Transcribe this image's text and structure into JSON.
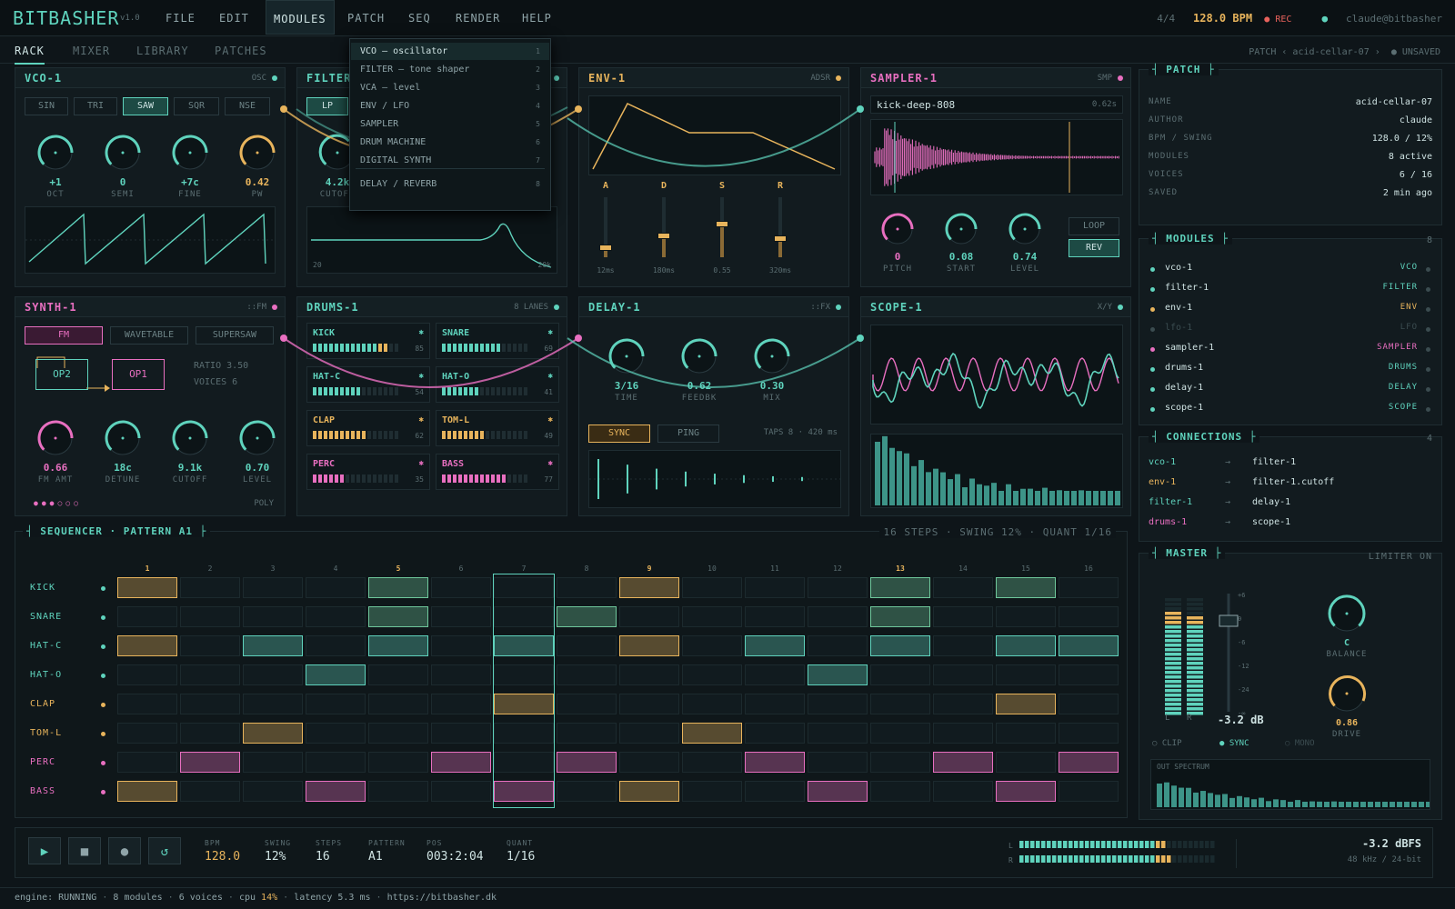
{
  "app": {
    "name": "BITBASHER",
    "version": "v1.0"
  },
  "menu": [
    "FILE",
    "EDIT",
    "MODULES",
    "PATCH",
    "SEQ",
    "RENDER",
    "HELP"
  ],
  "topbar": {
    "sig": "4/4",
    "bpm": "128.0 BPM",
    "rec": "● REC",
    "user": "claude@bitbasher"
  },
  "tabs": [
    "RACK",
    "MIXER",
    "LIBRARY",
    "PATCHES"
  ],
  "breadcrumb": {
    "text": "PATCH ‹ acid-cellar-07 ›",
    "status": "● UNSAVED"
  },
  "dropdown": [
    {
      "label": "VCO — oscillator",
      "key": "1"
    },
    {
      "label": "FILTER — tone shaper",
      "key": "2"
    },
    {
      "label": "VCA — level",
      "key": "3"
    },
    {
      "label": "ENV / LFO",
      "key": "4"
    },
    {
      "label": "SAMPLER",
      "key": "5"
    },
    {
      "label": "DRUM MACHINE",
      "key": "6"
    },
    {
      "label": "DIGITAL SYNTH",
      "key": "7"
    },
    {
      "label": "DELAY / REVERB",
      "key": "8"
    }
  ],
  "vco": {
    "title": "VCO-1",
    "tag": "OSC",
    "waves": [
      "SIN",
      "TRI",
      "SAW",
      "SQR",
      "NSE"
    ],
    "active_wave": "SAW",
    "knobs": [
      {
        "v": "+1",
        "l": "OCT"
      },
      {
        "v": "0",
        "l": "SEMI"
      },
      {
        "v": "+7c",
        "l": "FINE"
      },
      {
        "v": "0.42",
        "l": "PW"
      }
    ]
  },
  "filter": {
    "title": "FILTER-1",
    "mode": "LP",
    "cutoff_value": "4.2k",
    "cutoff_label": "CUTOFF",
    "axis_min": "20",
    "axis_max": "20k"
  },
  "env": {
    "title": "ENV-1",
    "tag": "ADSR",
    "sliders": [
      {
        "n": "A",
        "v": "12ms",
        "level": 0.15
      },
      {
        "n": "D",
        "v": "180ms",
        "level": 0.35
      },
      {
        "n": "S",
        "v": "0.55",
        "level": 0.55
      },
      {
        "n": "R",
        "v": "320ms",
        "level": 0.3
      }
    ]
  },
  "sampler": {
    "title": "SAMPLER-1",
    "tag": "SMP",
    "file": "kick-deep-808",
    "length": "0.62s",
    "loop": "LOOP",
    "rev": "REV",
    "knobs": [
      {
        "v": "0",
        "l": "PITCH"
      },
      {
        "v": "0.08",
        "l": "START"
      },
      {
        "v": "0.74",
        "l": "LEVEL"
      }
    ]
  },
  "synth": {
    "title": "SYNTH-1",
    "tag": "::FM",
    "modes": [
      "FM",
      "WAVETABLE",
      "SUPERSAW"
    ],
    "op2": "OP2",
    "op1": "OP1",
    "ratio": "RATIO 3.50",
    "voices": "VOICES  6",
    "poly": "POLY",
    "knobs": [
      {
        "v": "0.66",
        "l": "FM AMT"
      },
      {
        "v": "18c",
        "l": "DETUNE"
      },
      {
        "v": "9.1k",
        "l": "CUTOFF"
      },
      {
        "v": "0.70",
        "l": "LEVEL"
      }
    ]
  },
  "drums": {
    "title": "DRUMS-1",
    "tag": "8 LANES",
    "lanes": [
      {
        "n": "KICK",
        "v": "85",
        "c": "teal",
        "lvl": 0.85
      },
      {
        "n": "SNARE",
        "v": "69",
        "c": "teal",
        "lvl": 0.69
      },
      {
        "n": "HAT-C",
        "v": "54",
        "c": "teal",
        "lvl": 0.54
      },
      {
        "n": "HAT-O",
        "v": "41",
        "c": "teal",
        "lvl": 0.41
      },
      {
        "n": "CLAP",
        "v": "62",
        "c": "amber",
        "lvl": 0.62
      },
      {
        "n": "TOM-L",
        "v": "49",
        "c": "amber",
        "lvl": 0.49
      },
      {
        "n": "PERC",
        "v": "35",
        "c": "pink",
        "lvl": 0.35
      },
      {
        "n": "BASS",
        "v": "77",
        "c": "pink",
        "lvl": 0.77
      }
    ]
  },
  "delay": {
    "title": "DELAY-1",
    "tag": "::FX",
    "sync": "SYNC",
    "ping": "PING",
    "taps": "TAPS 8 · 420 ms",
    "knobs": [
      {
        "v": "3/16",
        "l": "TIME"
      },
      {
        "v": "0.62",
        "l": "FEEDBK"
      },
      {
        "v": "0.30",
        "l": "MIX"
      }
    ]
  },
  "scope": {
    "title": "SCOPE-1",
    "tag": "X/Y"
  },
  "patch": {
    "title": "PATCH",
    "rows": [
      {
        "k": "NAME",
        "v": "acid-cellar-07"
      },
      {
        "k": "AUTHOR",
        "v": "claude"
      },
      {
        "k": "BPM / SWING",
        "v": "128.0 / 12%"
      },
      {
        "k": "MODULES",
        "v": "8 active"
      },
      {
        "k": "VOICES",
        "v": "6 / 16"
      },
      {
        "k": "SAVED",
        "v": "2 min ago"
      }
    ]
  },
  "modules": {
    "title": "MODULES",
    "count": "8",
    "rows": [
      {
        "n": "vco-1",
        "t": "VCO",
        "c": "teal"
      },
      {
        "n": "filter-1",
        "t": "FILTER",
        "c": "teal"
      },
      {
        "n": "env-1",
        "t": "ENV",
        "c": "amber"
      },
      {
        "n": "lfo-1",
        "t": "LFO",
        "c": "dim"
      },
      {
        "n": "sampler-1",
        "t": "SAMPLER",
        "c": "pink"
      },
      {
        "n": "drums-1",
        "t": "DRUMS",
        "c": "teal"
      },
      {
        "n": "delay-1",
        "t": "DELAY",
        "c": "teal"
      },
      {
        "n": "scope-1",
        "t": "SCOPE",
        "c": "teal"
      }
    ]
  },
  "connections": {
    "title": "CONNECTIONS",
    "count": "4",
    "rows": [
      {
        "a": "vco-1",
        "b": "filter-1",
        "c": "teal"
      },
      {
        "a": "env-1",
        "b": "filter-1.cutoff",
        "c": "amber"
      },
      {
        "a": "filter-1",
        "b": "delay-1",
        "c": "teal"
      },
      {
        "a": "drums-1",
        "b": "scope-1",
        "c": "pink"
      }
    ]
  },
  "master": {
    "title": "MASTER",
    "limiter": "LIMITER ON",
    "db": "-3.2 dB",
    "balance_v": "C",
    "balance_l": "BALANCE",
    "drive_v": "0.86",
    "drive_l": "DRIVE",
    "clip": "○ CLIP",
    "sync": "● SYNC",
    "mono": "○ MONO",
    "spectrum": "OUT SPECTRUM",
    "scale": [
      "+6",
      "0",
      "-6",
      "-12",
      "-24",
      "-∞"
    ],
    "l": "L",
    "r": "R"
  },
  "sequencer": {
    "title": "SEQUENCER · PATTERN A1",
    "info": "16 STEPS · SWING 12% · QUANT 1/16",
    "current_step": 7,
    "lanes": [
      {
        "n": "KICK",
        "c": "teal",
        "steps": [
          {
            "s": 1,
            "c": "amber"
          },
          {
            "s": 5,
            "c": "green"
          },
          {
            "s": 9,
            "c": "amber"
          },
          {
            "s": 13,
            "c": "green"
          },
          {
            "s": 15,
            "c": "green"
          }
        ]
      },
      {
        "n": "SNARE",
        "c": "teal",
        "steps": [
          {
            "s": 5,
            "c": "green"
          },
          {
            "s": 8,
            "c": "green"
          },
          {
            "s": 13,
            "c": "green"
          }
        ]
      },
      {
        "n": "HAT-C",
        "c": "teal",
        "steps": [
          {
            "s": 1,
            "c": "amber"
          },
          {
            "s": 3,
            "c": "teal"
          },
          {
            "s": 5,
            "c": "teal"
          },
          {
            "s": 7,
            "c": "teal"
          },
          {
            "s": 9,
            "c": "amber"
          },
          {
            "s": 11,
            "c": "teal"
          },
          {
            "s": 13,
            "c": "teal"
          },
          {
            "s": 15,
            "c": "teal"
          },
          {
            "s": 16,
            "c": "teal"
          }
        ]
      },
      {
        "n": "HAT-O",
        "c": "teal",
        "steps": [
          {
            "s": 4,
            "c": "teal"
          },
          {
            "s": 12,
            "c": "teal"
          }
        ]
      },
      {
        "n": "CLAP",
        "c": "amber",
        "steps": [
          {
            "s": 7,
            "c": "amber"
          },
          {
            "s": 15,
            "c": "amber"
          }
        ]
      },
      {
        "n": "TOM-L",
        "c": "amber",
        "steps": [
          {
            "s": 3,
            "c": "amber"
          },
          {
            "s": 10,
            "c": "amber"
          }
        ]
      },
      {
        "n": "PERC",
        "c": "pink",
        "steps": [
          {
            "s": 2,
            "c": "pink"
          },
          {
            "s": 6,
            "c": "pink"
          },
          {
            "s": 8,
            "c": "pink"
          },
          {
            "s": 11,
            "c": "pink"
          },
          {
            "s": 14,
            "c": "pink"
          },
          {
            "s": 16,
            "c": "pink"
          }
        ]
      },
      {
        "n": "BASS",
        "c": "pink",
        "steps": [
          {
            "s": 1,
            "c": "amber"
          },
          {
            "s": 4,
            "c": "pink"
          },
          {
            "s": 7,
            "c": "pink"
          },
          {
            "s": 9,
            "c": "amber"
          },
          {
            "s": 12,
            "c": "pink"
          },
          {
            "s": 15,
            "c": "pink"
          }
        ]
      }
    ]
  },
  "transport": {
    "play": "▶",
    "stop": "■",
    "rec": "●",
    "loop": "↺",
    "fields": [
      {
        "l": "BPM",
        "v": "128.0"
      },
      {
        "l": "SWING",
        "v": "12%"
      },
      {
        "l": "STEPS",
        "v": "16"
      },
      {
        "l": "PATTERN",
        "v": "A1"
      },
      {
        "l": "POS",
        "v": "003:2:04"
      },
      {
        "l": "QUANT",
        "v": "1/16"
      }
    ],
    "dbfs": "-3.2 dBFS",
    "format": "48 kHz / 24-bit",
    "meter_l": "L",
    "meter_r": "R"
  },
  "status": {
    "engine": "engine: RUNNING",
    "modules": "8 modules",
    "voices": "6 voices",
    "cpu_label": "cpu",
    "cpu": "14%",
    "latency": "latency 5.3 ms",
    "url": "https://bitbasher.dk"
  },
  "colors": {
    "teal": "#5fd3bd",
    "amber": "#e8b45c",
    "pink": "#e86fc0",
    "green": "#6fc89c",
    "dim": "#3b4c50"
  }
}
